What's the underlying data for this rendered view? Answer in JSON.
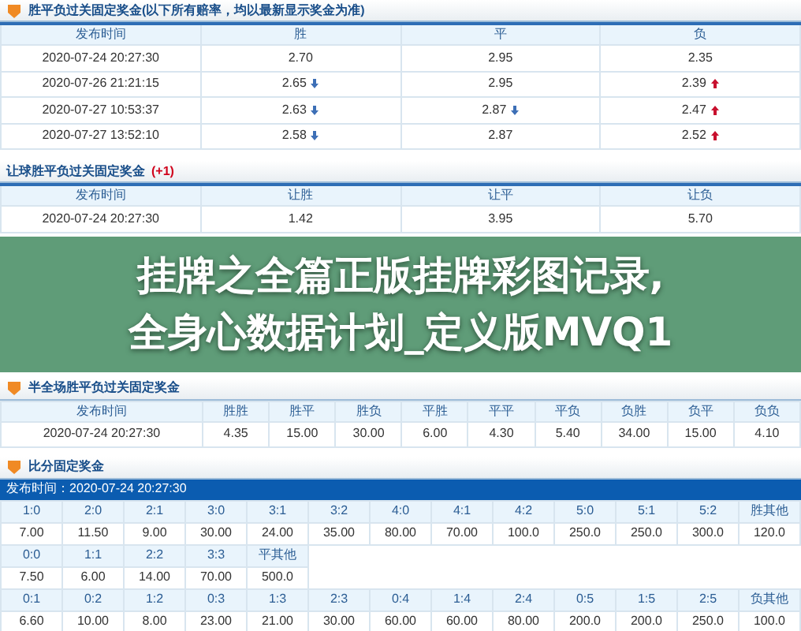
{
  "odds_tables": [
    {
      "title": "胜平负过关固定奖金(以下所有赔率，均以最新显示奖金为准)",
      "icon": true,
      "columns": [
        "发布时间",
        "胜",
        "平",
        "负"
      ],
      "rows": [
        [
          {
            "value": "2020-07-24 20:27:30"
          },
          {
            "value": "2.70"
          },
          {
            "value": "2.95"
          },
          {
            "value": "2.35"
          }
        ],
        [
          {
            "value": "2020-07-26 21:21:15"
          },
          {
            "value": "2.65",
            "kind": "down"
          },
          {
            "value": "2.95"
          },
          {
            "value": "2.39",
            "kind": "up"
          }
        ],
        [
          {
            "value": "2020-07-27 10:53:37"
          },
          {
            "value": "2.63",
            "kind": "down"
          },
          {
            "value": "2.87",
            "kind": "down"
          },
          {
            "value": "2.47",
            "kind": "up"
          }
        ],
        [
          {
            "value": "2020-07-27 13:52:10"
          },
          {
            "value": "2.58",
            "kind": "down"
          },
          {
            "value": "2.87"
          },
          {
            "value": "2.52",
            "kind": "up"
          }
        ]
      ]
    },
    {
      "title": "让球胜平负过关固定奖金",
      "title_note": "(+1)",
      "icon": false,
      "columns": [
        "发布时间",
        "让胜",
        "让平",
        "让负"
      ],
      "rows": [
        [
          {
            "value": "2020-07-24 20:27:30"
          },
          {
            "value": "1.42"
          },
          {
            "value": "3.95"
          },
          {
            "value": "5.70"
          }
        ]
      ]
    }
  ],
  "banner": {
    "lines": [
      "挂牌之全篇正版挂牌彩图记录,",
      "全身心数据计划_定义版MVQ1"
    ]
  },
  "half_full_table": {
    "title": "半全场胜平负过关固定奖金",
    "columns": [
      "发布时间",
      "胜胜",
      "胜平",
      "胜负",
      "平胜",
      "平平",
      "平负",
      "负胜",
      "负平",
      "负负"
    ],
    "rows": [
      [
        "2020-07-24 20:27:30",
        "4.35",
        "15.00",
        "30.00",
        "6.00",
        "4.30",
        "5.40",
        "34.00",
        "15.00",
        "4.10"
      ]
    ]
  },
  "score_table": {
    "title": "比分固定奖金",
    "publish_time": "发布时间：2020-07-24 20:27:30",
    "groups": [
      {
        "labels": [
          "1:0",
          "2:0",
          "2:1",
          "3:0",
          "3:1",
          "3:2",
          "4:0",
          "4:1",
          "4:2",
          "5:0",
          "5:1",
          "5:2",
          "胜其他"
        ],
        "values": [
          "7.00",
          "11.50",
          "9.00",
          "30.00",
          "24.00",
          "35.00",
          "80.00",
          "70.00",
          "100.0",
          "250.0",
          "250.0",
          "300.0",
          "120.0"
        ]
      },
      {
        "labels": [
          "0:0",
          "1:1",
          "2:2",
          "3:3",
          "平其他"
        ],
        "values": [
          "7.50",
          "6.00",
          "14.00",
          "70.00",
          "500.0"
        ]
      },
      {
        "labels": [
          "0:1",
          "0:2",
          "1:2",
          "0:3",
          "1:3",
          "2:3",
          "0:4",
          "1:4",
          "2:4",
          "0:5",
          "1:5",
          "2:5",
          "负其他"
        ],
        "values": [
          "6.60",
          "10.00",
          "8.00",
          "23.00",
          "21.00",
          "30.00",
          "60.00",
          "60.00",
          "80.00",
          "200.0",
          "200.0",
          "250.0",
          "100.0"
        ]
      }
    ]
  }
}
